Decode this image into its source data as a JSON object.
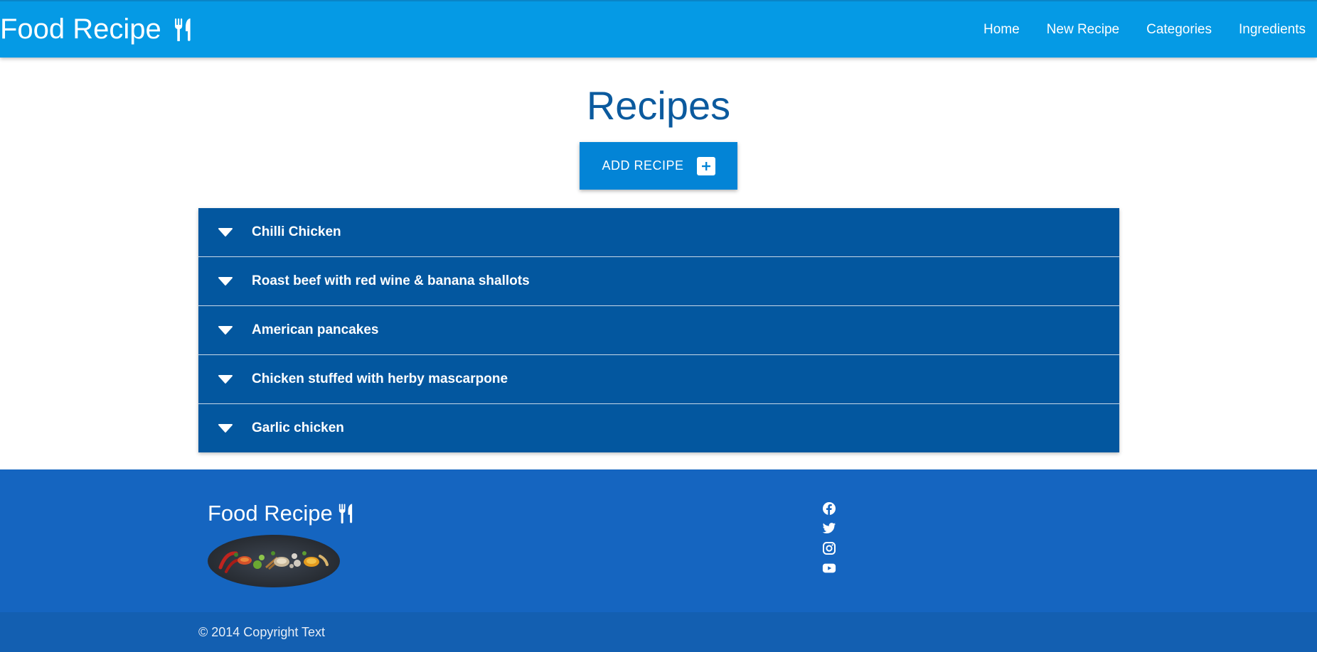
{
  "header": {
    "brand": "Food Recipe",
    "brand_icon": "utensils-icon",
    "nav": [
      {
        "label": "Home"
      },
      {
        "label": "New Recipe"
      },
      {
        "label": "Categories"
      },
      {
        "label": "Ingredients"
      }
    ]
  },
  "main": {
    "title": "Recipes",
    "add_button_label": "ADD RECIPE",
    "add_button_icon": "plus-square-icon",
    "recipes": [
      {
        "name": "Chilli Chicken"
      },
      {
        "name": "Roast beef with red wine & banana shallots"
      },
      {
        "name": "American pancakes"
      },
      {
        "name": "Chicken stuffed with herby mascarpone"
      },
      {
        "name": "Garlic chicken"
      }
    ]
  },
  "footer": {
    "brand": "Food Recipe",
    "brand_icon": "utensils-icon",
    "social": [
      "facebook-icon",
      "twitter-icon",
      "instagram-icon",
      "youtube-icon"
    ],
    "copyright": "© 2014 Copyright Text"
  },
  "colors": {
    "navbar": "#059ae5",
    "title": "#0b5a9e",
    "add_button": "#0384d6",
    "accordion": "#03579f",
    "footer": "#1565c0",
    "copyright_bar": "#135fb1"
  }
}
